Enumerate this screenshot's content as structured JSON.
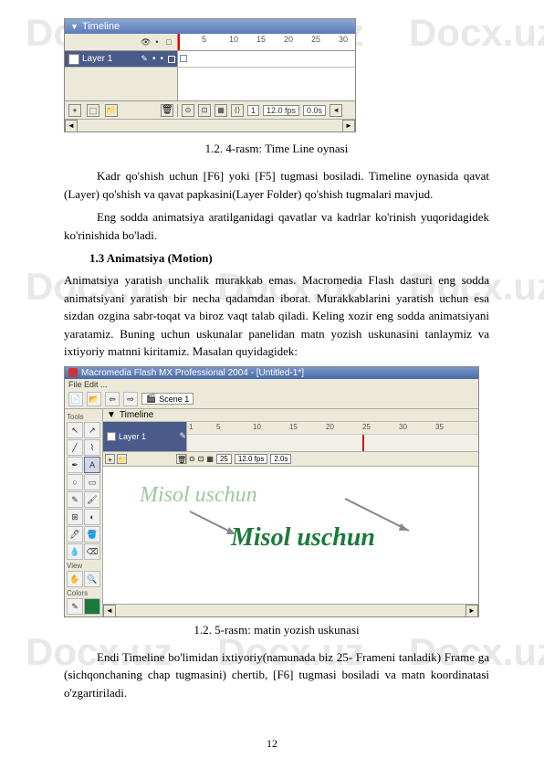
{
  "watermark": "Docx.uz",
  "screenshot1": {
    "title": "Timeline",
    "ruler": [
      "5",
      "10",
      "15",
      "20",
      "25",
      "30"
    ],
    "layer_name": "Layer 1",
    "frame_num": "1",
    "fps": "12.0 fps",
    "time": "0.0s"
  },
  "caption1": "1.2. 4-rasm: Time  Line oynasi",
  "para1": "Kadr qo'shish uchun [F6] yoki [F5] tugmasi bosiladi. Timeline oynasida qavat (Layer) qo'shish va qavat papkasini(Layer Folder) qo'shish tugmalari mavjud.",
  "para2": "Eng sodda animatsiya aratilganidagi qavatlar va kadrlar ko'rinish yuqoridagidek ko'rinishida bo'ladi.",
  "heading": "1.3 Animatsiya (Motion)",
  "para3": "Animatsiya yaratish unchalik murakkab emas. Macromedia Flash dasturi eng sodda animatsiyani yaratish bir necha qadamdan iborat. Murakkablarini yaratish uchun esa sizdan ozgina sabr-toqat va biroz vaqt talab qiladi. Keling xozir eng sodda animatsiyani yaratamiz. Buning uchun uskunalar panelidan matn yozish uskunasini tanlaymiz va ixtiyoriy matnni kiritamiz. Masalan quyidagidek:",
  "screenshot2": {
    "title": "Macromedia Flash MX Professional 2004 - [Untitled-1*]",
    "menu": "File  Edit ...",
    "scene": "Scene 1",
    "tools_label": "Tools",
    "view_label": "View",
    "colors_label": "Colors",
    "timeline_label": "Timeline",
    "layer_name": "Layer 1",
    "ruler": [
      "1",
      "5",
      "10",
      "15",
      "20",
      "25",
      "30",
      "35"
    ],
    "frame_num": "25",
    "fps": "12.0 fps",
    "time": "2.0s",
    "text1": "Misol uschun",
    "text2": "Misol uschun"
  },
  "caption2": "1.2. 5-rasm:  matin yozish uskunasi",
  "para4": "Endi Timeline bo'limidan ixtiyoriy(namunada biz 25- Frameni tanladik) Frame ga (sichqonchaning chap tugmasini) chertib, [F6] tugmasi bosiladi va matn koordinatasi o'zgartiriladi.",
  "page_number": "12"
}
